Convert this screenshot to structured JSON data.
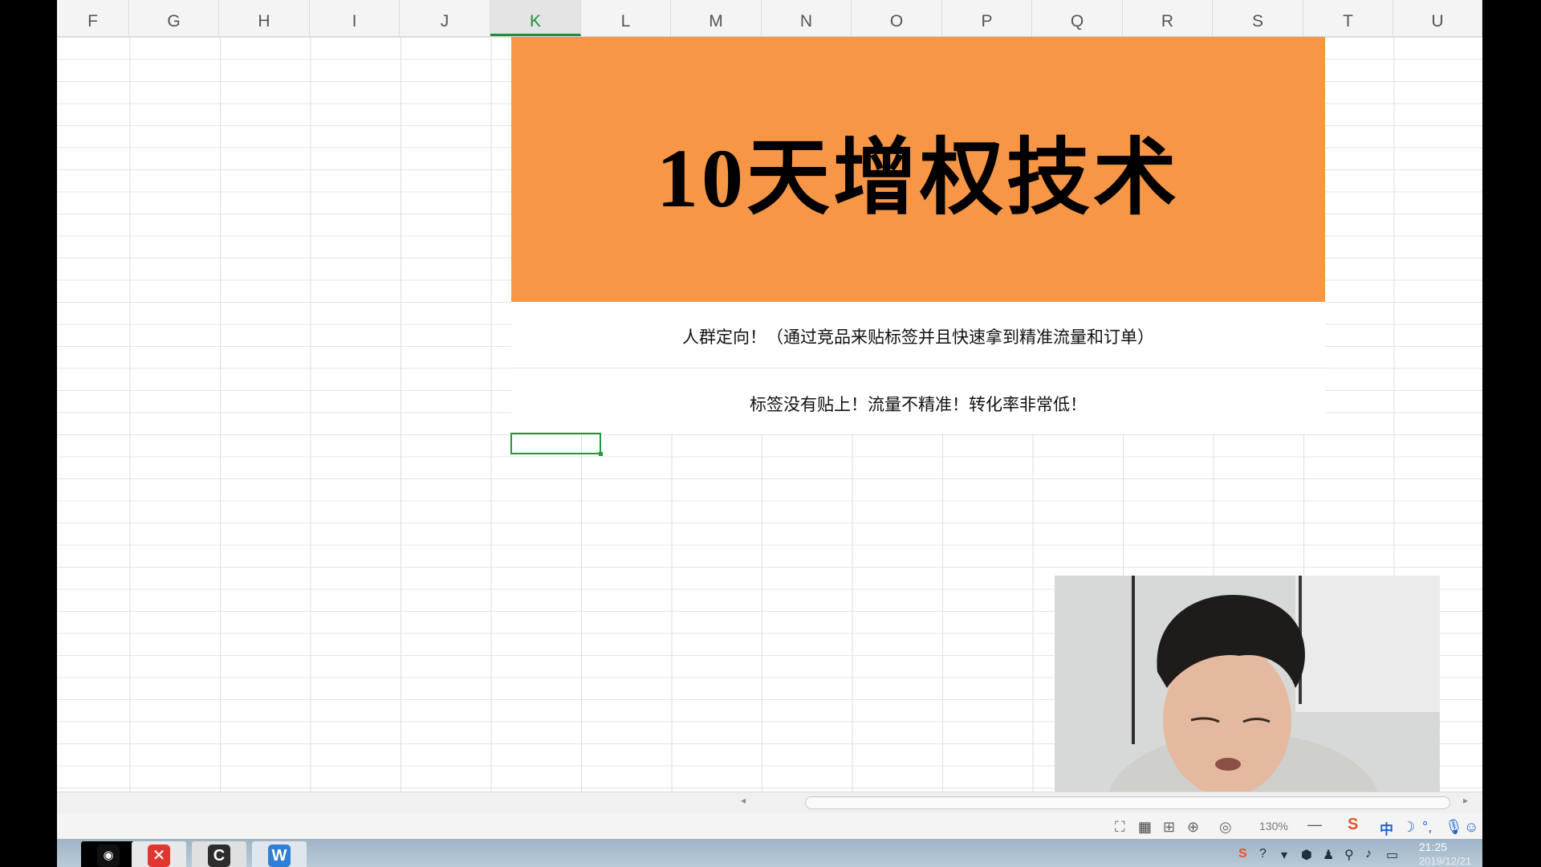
{
  "spreadsheet": {
    "columns": [
      "F",
      "G",
      "H",
      "I",
      "J",
      "K",
      "L",
      "M",
      "N",
      "O",
      "P",
      "Q",
      "R",
      "S",
      "T",
      "U"
    ],
    "active_column": "K",
    "banner_title": "10天增权技术",
    "banner_color": "#f79646",
    "line1": "人群定向！（通过竞品来贴标签并且快速拿到精准流量和订单）",
    "line2": "标签没有贴上！流量不精准！转化率非常低！",
    "selection_color": "#1f9a3a"
  },
  "statusbar": {
    "zoom": "130%",
    "zoom_minus": "—",
    "ime_logo": "S",
    "ime_mode": "中"
  },
  "taskbar": {
    "apps": [
      {
        "name": "OBS",
        "icon": "obs-icon"
      },
      {
        "name": "XMind",
        "icon": "xmind-icon"
      },
      {
        "name": "Camtasia",
        "icon": "camtasia-icon"
      },
      {
        "name": "WPS",
        "icon": "wps-icon"
      }
    ],
    "time": "21:25",
    "date": "2019/12/21"
  }
}
